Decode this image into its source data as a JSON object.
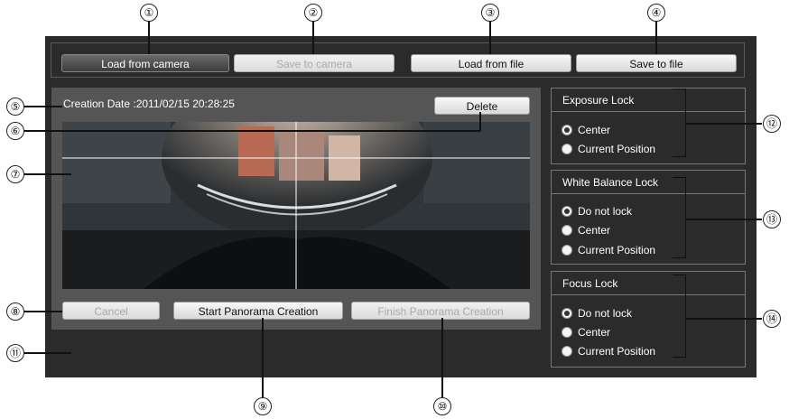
{
  "callouts": [
    "①",
    "②",
    "③",
    "④",
    "⑤",
    "⑥",
    "⑦",
    "⑧",
    "⑨",
    "⑩",
    "⑪",
    "⑫",
    "⑬",
    "⑭"
  ],
  "toolbar": {
    "load_from_camera": "Load from camera",
    "save_to_camera": "Save to camera",
    "load_from_file": "Load from file",
    "save_to_file": "Save to file"
  },
  "creation_date": "Creation Date :2011/02/15 20:28:25",
  "delete_label": "Delete",
  "actions": {
    "cancel": "Cancel",
    "start": "Start Panorama Creation",
    "finish": "Finish Panorama Creation"
  },
  "exposure_lock": {
    "title": "Exposure Lock",
    "options": [
      "Center",
      "Current Position"
    ],
    "selected": "Center"
  },
  "white_balance_lock": {
    "title": "White Balance Lock",
    "options": [
      "Do not lock",
      "Center",
      "Current Position"
    ],
    "selected": "Do not lock"
  },
  "focus_lock": {
    "title": "Focus Lock",
    "options": [
      "Do not lock",
      "Center",
      "Current Position"
    ],
    "selected": "Do not lock"
  }
}
